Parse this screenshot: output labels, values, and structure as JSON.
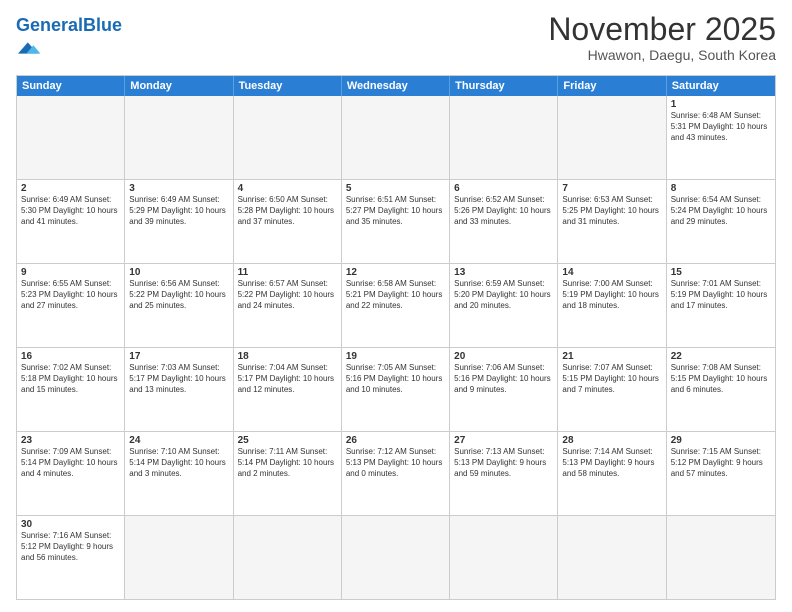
{
  "header": {
    "logo_general": "General",
    "logo_blue": "Blue",
    "month_title": "November 2025",
    "location": "Hwawon, Daegu, South Korea"
  },
  "day_headers": [
    "Sunday",
    "Monday",
    "Tuesday",
    "Wednesday",
    "Thursday",
    "Friday",
    "Saturday"
  ],
  "weeks": [
    [
      {
        "day": "",
        "empty": true
      },
      {
        "day": "",
        "empty": true
      },
      {
        "day": "",
        "empty": true
      },
      {
        "day": "",
        "empty": true
      },
      {
        "day": "",
        "empty": true
      },
      {
        "day": "",
        "empty": true
      },
      {
        "day": "1",
        "info": "Sunrise: 6:48 AM\nSunset: 5:31 PM\nDaylight: 10 hours and 43 minutes."
      }
    ],
    [
      {
        "day": "2",
        "info": "Sunrise: 6:49 AM\nSunset: 5:30 PM\nDaylight: 10 hours and 41 minutes."
      },
      {
        "day": "3",
        "info": "Sunrise: 6:49 AM\nSunset: 5:29 PM\nDaylight: 10 hours and 39 minutes."
      },
      {
        "day": "4",
        "info": "Sunrise: 6:50 AM\nSunset: 5:28 PM\nDaylight: 10 hours and 37 minutes."
      },
      {
        "day": "5",
        "info": "Sunrise: 6:51 AM\nSunset: 5:27 PM\nDaylight: 10 hours and 35 minutes."
      },
      {
        "day": "6",
        "info": "Sunrise: 6:52 AM\nSunset: 5:26 PM\nDaylight: 10 hours and 33 minutes."
      },
      {
        "day": "7",
        "info": "Sunrise: 6:53 AM\nSunset: 5:25 PM\nDaylight: 10 hours and 31 minutes."
      },
      {
        "day": "8",
        "info": "Sunrise: 6:54 AM\nSunset: 5:24 PM\nDaylight: 10 hours and 29 minutes."
      }
    ],
    [
      {
        "day": "9",
        "info": "Sunrise: 6:55 AM\nSunset: 5:23 PM\nDaylight: 10 hours and 27 minutes."
      },
      {
        "day": "10",
        "info": "Sunrise: 6:56 AM\nSunset: 5:22 PM\nDaylight: 10 hours and 25 minutes."
      },
      {
        "day": "11",
        "info": "Sunrise: 6:57 AM\nSunset: 5:22 PM\nDaylight: 10 hours and 24 minutes."
      },
      {
        "day": "12",
        "info": "Sunrise: 6:58 AM\nSunset: 5:21 PM\nDaylight: 10 hours and 22 minutes."
      },
      {
        "day": "13",
        "info": "Sunrise: 6:59 AM\nSunset: 5:20 PM\nDaylight: 10 hours and 20 minutes."
      },
      {
        "day": "14",
        "info": "Sunrise: 7:00 AM\nSunset: 5:19 PM\nDaylight: 10 hours and 18 minutes."
      },
      {
        "day": "15",
        "info": "Sunrise: 7:01 AM\nSunset: 5:19 PM\nDaylight: 10 hours and 17 minutes."
      }
    ],
    [
      {
        "day": "16",
        "info": "Sunrise: 7:02 AM\nSunset: 5:18 PM\nDaylight: 10 hours and 15 minutes."
      },
      {
        "day": "17",
        "info": "Sunrise: 7:03 AM\nSunset: 5:17 PM\nDaylight: 10 hours and 13 minutes."
      },
      {
        "day": "18",
        "info": "Sunrise: 7:04 AM\nSunset: 5:17 PM\nDaylight: 10 hours and 12 minutes."
      },
      {
        "day": "19",
        "info": "Sunrise: 7:05 AM\nSunset: 5:16 PM\nDaylight: 10 hours and 10 minutes."
      },
      {
        "day": "20",
        "info": "Sunrise: 7:06 AM\nSunset: 5:16 PM\nDaylight: 10 hours and 9 minutes."
      },
      {
        "day": "21",
        "info": "Sunrise: 7:07 AM\nSunset: 5:15 PM\nDaylight: 10 hours and 7 minutes."
      },
      {
        "day": "22",
        "info": "Sunrise: 7:08 AM\nSunset: 5:15 PM\nDaylight: 10 hours and 6 minutes."
      }
    ],
    [
      {
        "day": "23",
        "info": "Sunrise: 7:09 AM\nSunset: 5:14 PM\nDaylight: 10 hours and 4 minutes."
      },
      {
        "day": "24",
        "info": "Sunrise: 7:10 AM\nSunset: 5:14 PM\nDaylight: 10 hours and 3 minutes."
      },
      {
        "day": "25",
        "info": "Sunrise: 7:11 AM\nSunset: 5:14 PM\nDaylight: 10 hours and 2 minutes."
      },
      {
        "day": "26",
        "info": "Sunrise: 7:12 AM\nSunset: 5:13 PM\nDaylight: 10 hours and 0 minutes."
      },
      {
        "day": "27",
        "info": "Sunrise: 7:13 AM\nSunset: 5:13 PM\nDaylight: 9 hours and 59 minutes."
      },
      {
        "day": "28",
        "info": "Sunrise: 7:14 AM\nSunset: 5:13 PM\nDaylight: 9 hours and 58 minutes."
      },
      {
        "day": "29",
        "info": "Sunrise: 7:15 AM\nSunset: 5:12 PM\nDaylight: 9 hours and 57 minutes."
      }
    ],
    [
      {
        "day": "30",
        "info": "Sunrise: 7:16 AM\nSunset: 5:12 PM\nDaylight: 9 hours and 56 minutes."
      },
      {
        "day": "",
        "empty": true
      },
      {
        "day": "",
        "empty": true
      },
      {
        "day": "",
        "empty": true
      },
      {
        "day": "",
        "empty": true
      },
      {
        "day": "",
        "empty": true
      },
      {
        "day": "",
        "empty": true
      }
    ]
  ]
}
